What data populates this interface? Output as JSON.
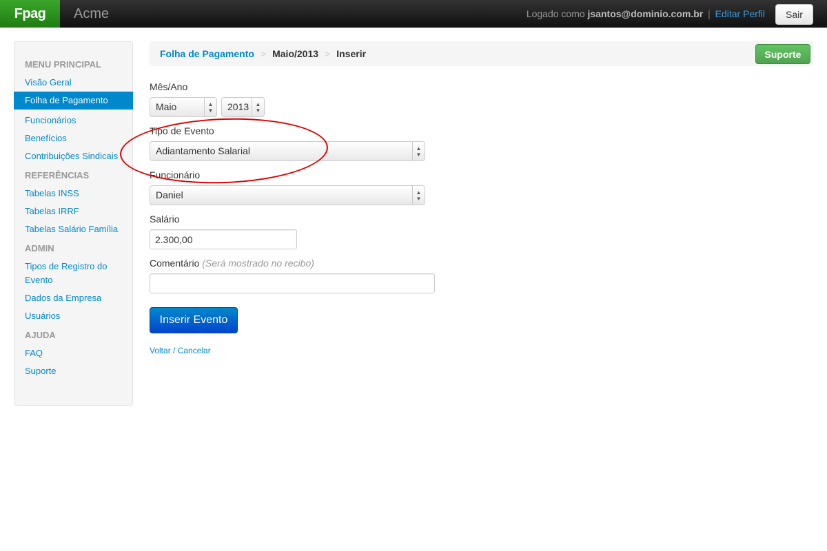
{
  "navbar": {
    "brand": "Fpag",
    "company": "Acme",
    "logged_prefix": "Logado como",
    "user_email": "jsantos@dominio.com.br",
    "separator": "|",
    "edit_profile": "Editar Perfil",
    "logout": "Sair"
  },
  "sidebar": {
    "sections": [
      {
        "header": "MENU PRINCIPAL",
        "items": [
          "Visão Geral",
          "Folha de Pagamento",
          "Funcionários",
          "Benefícios",
          "Contribuições Sindicais"
        ]
      },
      {
        "header": "REFERÊNCIAS",
        "items": [
          "Tabelas INSS",
          "Tabelas IRRF",
          "Tabelas Salário Família"
        ]
      },
      {
        "header": "ADMIN",
        "items": [
          "Tipos de Registro do Evento",
          "Dados da Empresa",
          "Usuários"
        ]
      },
      {
        "header": "AJUDA",
        "items": [
          "FAQ",
          "Suporte"
        ]
      }
    ],
    "active_item": "Folha de Pagamento"
  },
  "breadcrumb": {
    "items": [
      "Folha de Pagamento",
      "Maio/2013",
      "Inserir"
    ],
    "divider": ">",
    "support_button": "Suporte"
  },
  "form": {
    "month_year_label": "Mês/Ano",
    "month_value": "Maio",
    "year_value": "2013",
    "event_type_label": "Tipo de Evento",
    "event_type_value": "Adiantamento Salarial",
    "employee_label": "Funcionário",
    "employee_value": "Daniel",
    "salary_label": "Salário",
    "salary_value": "2.300,00",
    "comment_label": "Comentário",
    "comment_hint": "(Será mostrado no recibo)",
    "comment_value": "",
    "submit_label": "Inserir Evento",
    "cancel_label": "Voltar / Cancelar"
  },
  "colors": {
    "brand_green": "#2e9420",
    "link_blue": "#0088cc",
    "primary_blue": "#0055cc",
    "success_green": "#5bb75b",
    "annotation_red": "#e00000"
  }
}
